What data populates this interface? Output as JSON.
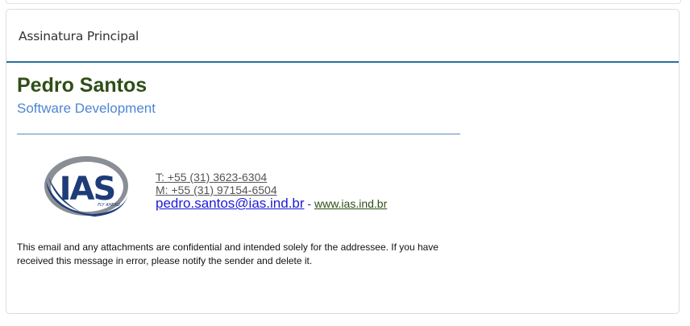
{
  "panel": {
    "title": "Assinatura Principal"
  },
  "signature": {
    "name": "Pedro Santos",
    "role": "Software Development",
    "logo_text": "IAS",
    "logo_tagline": "FLY AHEAD",
    "phone": "T: +55 (31) 3623-6304",
    "mobile": "M: +55 (31) 97154-6504",
    "email": "pedro.santos@ias.ind.br",
    "separator": " - ",
    "website": "www.ias.ind.br",
    "disclaimer": "This email and any attachments are confidential and intended solely for the addressee. If you have received this message in error, please notify the sender and delete it."
  },
  "colors": {
    "name": "#2e4e16",
    "role": "#4f86d1",
    "header_rule": "#2b6f9e",
    "email_link": "#1a1ad6",
    "logo_navy": "#1d3c78",
    "logo_gray": "#8a8f96"
  }
}
